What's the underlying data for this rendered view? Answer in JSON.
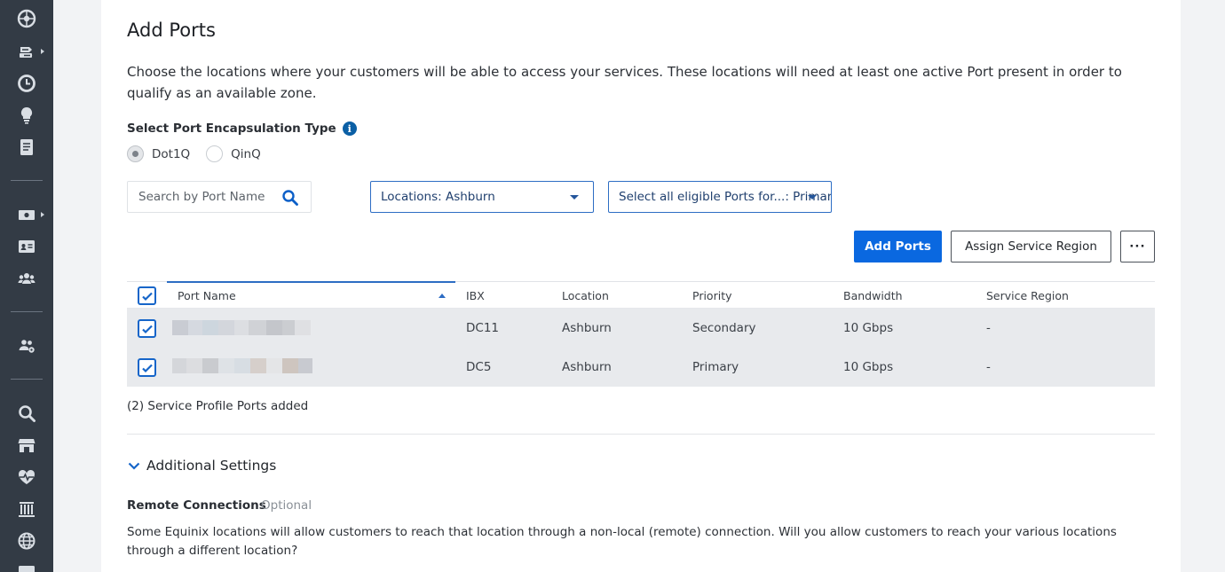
{
  "page": {
    "title": "Add Ports",
    "description": "Choose the locations where your customers will be able to access your services. These locations will need at least one active Port present in order to qualify as an available zone."
  },
  "encapsulation": {
    "label": "Select Port Encapsulation Type",
    "options": [
      {
        "label": "Dot1Q",
        "selected": true
      },
      {
        "label": "QinQ",
        "selected": false
      }
    ]
  },
  "filters": {
    "search_placeholder": "Search by Port Name",
    "locations_dropdown": "Locations: Ashburn",
    "ports_dropdown": "Select all eligible Ports for...: Primary"
  },
  "actions": {
    "add_ports": "Add Ports",
    "assign_service_region": "Assign Service Region",
    "more": "···"
  },
  "table": {
    "columns": [
      "Port Name",
      "IBX",
      "Location",
      "Priority",
      "Bandwidth",
      "Service Region"
    ],
    "rows": [
      {
        "port_name": "",
        "ibx": "DC11",
        "location": "Ashburn",
        "priority": "Secondary",
        "bandwidth": "10 Gbps",
        "service_region": "-"
      },
      {
        "port_name": "",
        "ibx": "DC5",
        "location": "Ashburn",
        "priority": "Primary",
        "bandwidth": "10 Gbps",
        "service_region": "-"
      }
    ]
  },
  "summary": {
    "ports_added": "(2) Service Profile Ports added"
  },
  "additional_settings": {
    "label": "Additional Settings",
    "remote_connections_label": "Remote Connections",
    "remote_connections_optional": "Optional",
    "remote_connections_desc": "Some Equinix locations will allow customers to reach that location through a non-local (remote) connection. Will you allow customers to reach your various locations through a different location?"
  },
  "colors": {
    "rail_bg": "#333b45",
    "primary_blue": "#0a68e0",
    "link_blue": "#2d6dc4",
    "row_bg": "#e8eaed"
  },
  "rail_icons": [
    "globe-network-icon",
    "exchange-icon",
    "clock-icon",
    "lightbulb-icon",
    "document-icon",
    "billing-icon",
    "id-card-icon",
    "users-icon",
    "user-group-settings-icon",
    "search-icon",
    "marketplace-store-icon",
    "health-heart-icon",
    "building-columns-icon",
    "globe-icon",
    "news-icon"
  ]
}
